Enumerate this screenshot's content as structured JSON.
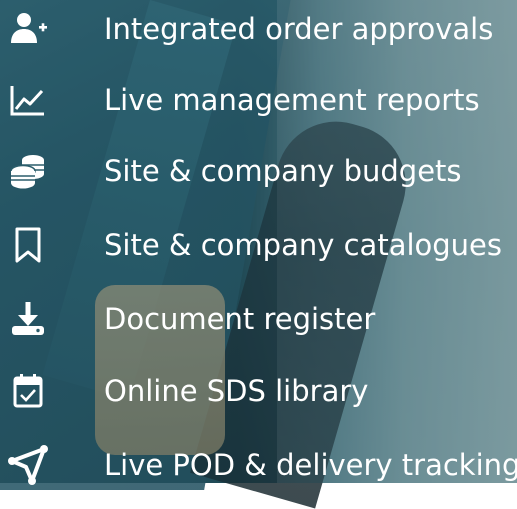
{
  "features": [
    {
      "label": "Integrated order approvals",
      "icon": "user-plus-icon"
    },
    {
      "label": "Live management reports",
      "icon": "line-chart-icon"
    },
    {
      "label": "Site & company budgets",
      "icon": "coins-icon"
    },
    {
      "label": "Site & company catalogues",
      "icon": "bookmark-icon"
    },
    {
      "label": "Document register",
      "icon": "download-icon"
    },
    {
      "label": "Online SDS library",
      "icon": "calendar-check-icon"
    },
    {
      "label": "Live POD & delivery tracking",
      "icon": "send-icon"
    }
  ],
  "colors": {
    "text": "#ffffff",
    "icon": "#ffffff"
  }
}
